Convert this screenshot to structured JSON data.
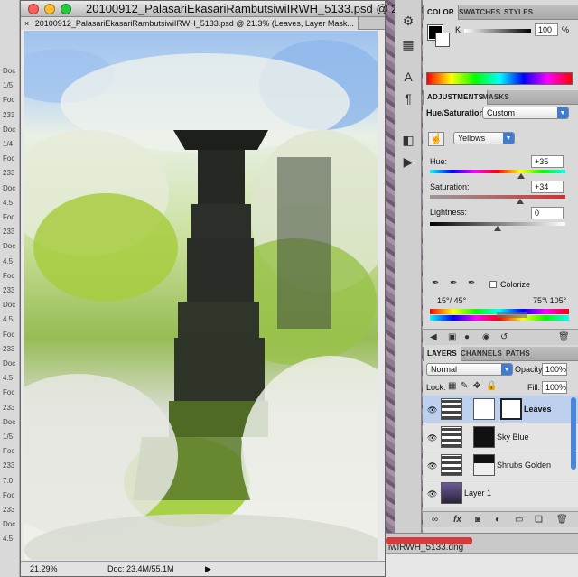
{
  "background_window": {
    "lines": [
      "Doc",
      "1/5",
      "Foc",
      "233",
      "Doc",
      "1/4",
      "Foc",
      "233",
      "Doc",
      "4.5",
      "Foc",
      "233",
      "Doc",
      "4.5",
      "Foc",
      "233",
      "Doc",
      "4.5",
      "Foc",
      "233",
      "Doc",
      "4.5",
      "Foc",
      "233",
      "Doc",
      "1/5",
      "Foc",
      "233",
      "7.0",
      "Foc",
      "233",
      "Doc",
      "4.5"
    ]
  },
  "document": {
    "window_title": "20100912_PalasariEkasariRambutsiwiIRWH_5133.psd @ 21.3% (...",
    "tab_label": "20100912_PalasariEkasariRambutsiwiIRWH_5133.psd @ 21.3% (Leaves, Layer Mask...",
    "tab_close": "×",
    "zoom": "21.29%",
    "doc_size": "Doc: 23.4M/55.1M",
    "status_arrow": "▶"
  },
  "background_document": {
    "filename": "iwIRWH_5133.dng"
  },
  "color_panel": {
    "tabs": [
      "COLOR",
      "SWATCHES",
      "STYLES"
    ],
    "channel_label": "K",
    "channel_value": "100",
    "percent": "%"
  },
  "adjustments_panel": {
    "tabs": [
      "ADJUSTMENTS",
      "MASKS"
    ],
    "adjustment_name": "Hue/Saturation",
    "preset": "Custom",
    "channel": "Yellows",
    "hue_label": "Hue:",
    "hue_value": "+35",
    "saturation_label": "Saturation:",
    "saturation_value": "+34",
    "lightness_label": "Lightness:",
    "lightness_value": "0",
    "colorize_label": "Colorize",
    "range_left": "15°/ 45°",
    "range_right": "75°\\ 105°"
  },
  "layers_panel": {
    "tabs": [
      "LAYERS",
      "CHANNELS",
      "PATHS"
    ],
    "blend_mode": "Normal",
    "opacity_label": "Opacity:",
    "opacity_value": "100%",
    "lock_label": "Lock:",
    "fill_label": "Fill:",
    "fill_value": "100%",
    "layers": [
      {
        "name": "Leaves",
        "selected": true
      },
      {
        "name": "Sky Blue",
        "selected": false
      },
      {
        "name": "Shrubs Golden",
        "selected": false
      },
      {
        "name": "Layer 1",
        "selected": false
      }
    ],
    "footer_icons": [
      "link-icon",
      "fx-icon",
      "mask-icon",
      "adjustment-icon",
      "group-icon",
      "new-layer-icon",
      "trash-icon"
    ]
  },
  "colors": {
    "selected_layer": "#bcd0ee",
    "dropdown_arrow": "#3d7bd6",
    "title_red": "#ff5f57",
    "title_yellow": "#febc2e",
    "title_green": "#28c840"
  }
}
